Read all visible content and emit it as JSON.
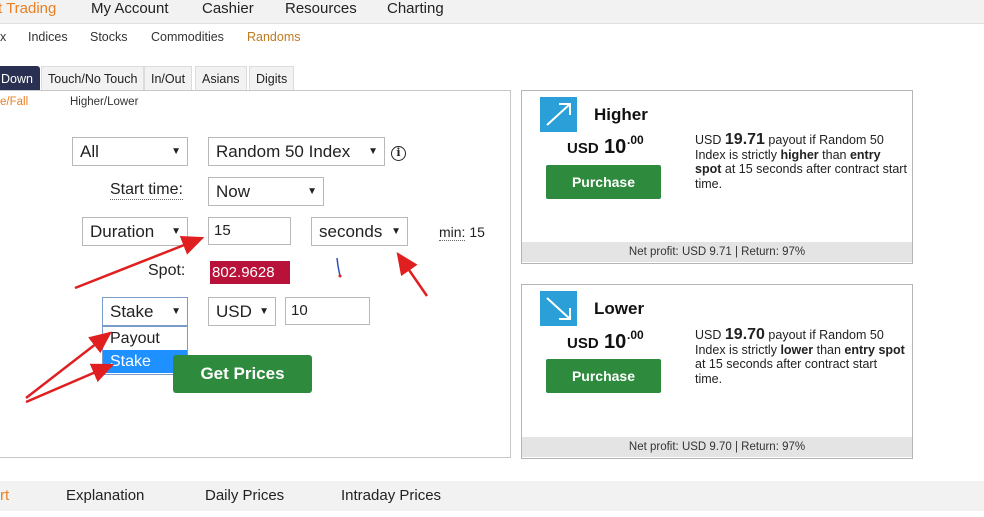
{
  "top_nav": {
    "items": [
      "t Trading",
      "My Account",
      "Cashier",
      "Resources",
      "Charting"
    ],
    "active_index": 0
  },
  "sub_nav": {
    "items": [
      "x",
      "Indices",
      "Stocks",
      "Commodities",
      "Randoms"
    ],
    "active_index": 4
  },
  "contract_tabs": {
    "items": [
      "Down",
      "Touch/No Touch",
      "In/Out",
      "Asians",
      "Digits"
    ],
    "active_index": 0
  },
  "panel": {
    "subtabs": [
      "e/Fall",
      "Higher/Lower"
    ],
    "active_subtab": 0,
    "market_select": "All",
    "underlying_select": "Random 50 Index",
    "info_icon": "info-circle-icon",
    "start_time_label": "Start time:",
    "start_time_value": "Now",
    "duration_select": "Duration",
    "duration_value": "15",
    "duration_unit": "seconds",
    "min_label": "min:",
    "min_value": "15",
    "spot_label": "Spot:",
    "spot_value": "802.9628",
    "amount_type_select": "Stake",
    "amount_type_options": [
      "Payout",
      "Stake"
    ],
    "amount_type_selected_option": "Stake",
    "currency_select": "USD",
    "amount_value": "10",
    "get_prices_label": "Get Prices"
  },
  "cards": [
    {
      "title": "Higher",
      "icon": "arrow-up-right-icon",
      "price_currency": "USD",
      "price_int": "10",
      "price_dec": ".00",
      "purchase_label": "Purchase",
      "desc_prefix": "USD",
      "payout": "19.71",
      "desc_mid": "payout if Random 50 Index is strictly",
      "direction": "higher",
      "desc_than": "than",
      "entry_spot": "entry spot",
      "desc_end": "at 15 seconds after contract start time.",
      "footer": "Net profit: USD 9.71 | Return: 97%"
    },
    {
      "title": "Lower",
      "icon": "arrow-down-right-icon",
      "price_currency": "USD",
      "price_int": "10",
      "price_dec": ".00",
      "purchase_label": "Purchase",
      "desc_prefix": "USD",
      "payout": "19.70",
      "desc_mid": "payout if Random 50 Index is strictly",
      "direction": "lower",
      "desc_than": "than",
      "entry_spot": "entry spot",
      "desc_end": "at 15 seconds after contract start time.",
      "footer": "Net profit: USD 9.70 | Return: 97%"
    }
  ],
  "bottom_nav": {
    "items": [
      "rt",
      "Explanation",
      "Daily Prices",
      "Intraday Prices"
    ],
    "active_index": 0
  },
  "colors": {
    "accent_orange": "#e98024",
    "tab_active": "#2a3052",
    "button_green": "#2e8b3d",
    "spot_red": "#b8123a",
    "icon_blue": "#2a9fd8",
    "annotation_arrow": "#e02020"
  }
}
